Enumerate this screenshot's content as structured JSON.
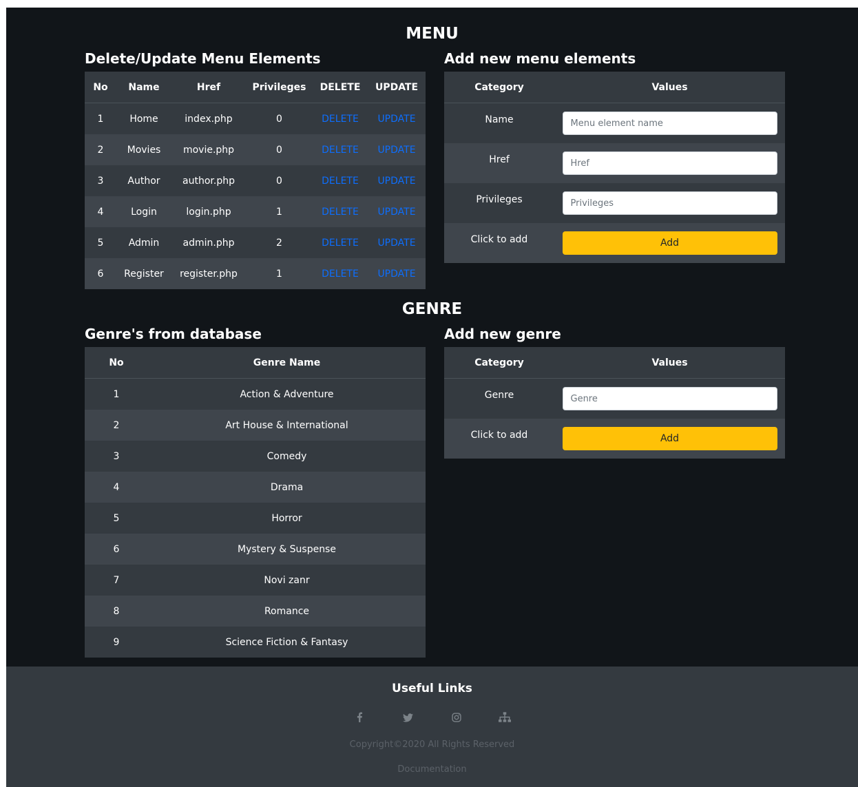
{
  "menu_section": {
    "title": "MENU",
    "list_title": "Delete/Update Menu Elements",
    "form_title": "Add new menu elements",
    "table": {
      "headers": [
        "No",
        "Name",
        "Href",
        "Privileges",
        "DELETE",
        "UPDATE"
      ],
      "rows": [
        {
          "no": "1",
          "name": "Home",
          "href": "index.php",
          "privileges": "0",
          "delete": "DELETE",
          "update": "UPDATE"
        },
        {
          "no": "2",
          "name": "Movies",
          "href": "movie.php",
          "privileges": "0",
          "delete": "DELETE",
          "update": "UPDATE"
        },
        {
          "no": "3",
          "name": "Author",
          "href": "author.php",
          "privileges": "0",
          "delete": "DELETE",
          "update": "UPDATE"
        },
        {
          "no": "4",
          "name": "Login",
          "href": "login.php",
          "privileges": "1",
          "delete": "DELETE",
          "update": "UPDATE"
        },
        {
          "no": "5",
          "name": "Admin",
          "href": "admin.php",
          "privileges": "2",
          "delete": "DELETE",
          "update": "UPDATE"
        },
        {
          "no": "6",
          "name": "Register",
          "href": "register.php",
          "privileges": "1",
          "delete": "DELETE",
          "update": "UPDATE"
        }
      ]
    },
    "form": {
      "headers": [
        "Category",
        "Values"
      ],
      "name_label": "Name",
      "name_placeholder": "Menu element name",
      "href_label": "Href",
      "href_placeholder": "Href",
      "privileges_label": "Privileges",
      "privileges_placeholder": "Privileges",
      "add_label": "Click to add",
      "add_button": "Add"
    }
  },
  "genre_section": {
    "title": "GENRE",
    "list_title": "Genre's from database",
    "form_title": "Add new genre",
    "table": {
      "headers": [
        "No",
        "Genre Name"
      ],
      "rows": [
        {
          "no": "1",
          "name": "Action & Adventure"
        },
        {
          "no": "2",
          "name": "Art House & International"
        },
        {
          "no": "3",
          "name": "Comedy"
        },
        {
          "no": "4",
          "name": "Drama"
        },
        {
          "no": "5",
          "name": "Horror"
        },
        {
          "no": "6",
          "name": "Mystery & Suspense"
        },
        {
          "no": "7",
          "name": "Novi zanr"
        },
        {
          "no": "8",
          "name": "Romance"
        },
        {
          "no": "9",
          "name": "Science Fiction & Fantasy"
        }
      ]
    },
    "form": {
      "headers": [
        "Category",
        "Values"
      ],
      "genre_label": "Genre",
      "genre_placeholder": "Genre",
      "add_label": "Click to add",
      "add_button": "Add"
    }
  },
  "footer": {
    "title": "Useful Links",
    "icons": [
      "facebook-icon",
      "twitter-icon",
      "instagram-icon",
      "sitemap-icon"
    ],
    "copyright": "Copyright©2020 All Rights Reserved",
    "documentation": "Documentation"
  },
  "colors": {
    "page_bg": "#111519",
    "table_dark": "#343a40",
    "table_light": "#3f454c",
    "link": "#0d6efd",
    "button": "#ffc107"
  }
}
